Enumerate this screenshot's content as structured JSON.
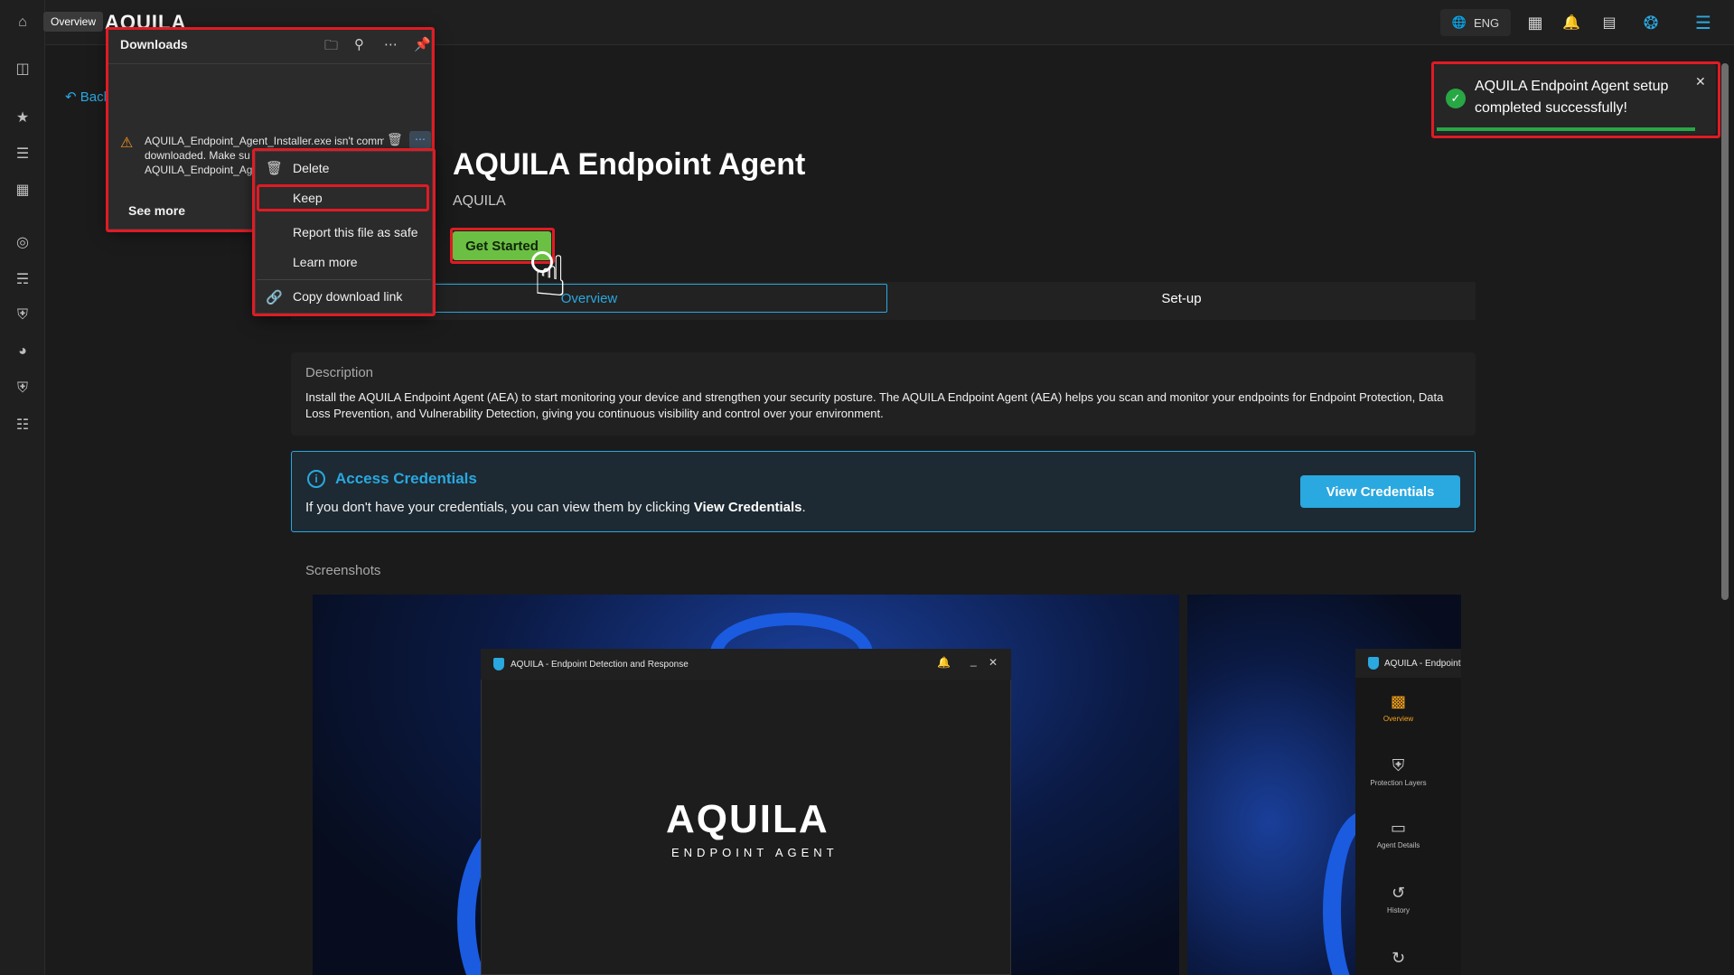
{
  "tooltip": "Overview",
  "brand": "AQUILA",
  "topbar": {
    "lang": "ENG"
  },
  "back_label": "Back",
  "product": {
    "title": "AQUILA Endpoint Agent",
    "vendor": "AQUILA",
    "get_started": "Get Started"
  },
  "tabs": [
    {
      "label": "Overview"
    },
    {
      "label": "Set-up"
    }
  ],
  "description": {
    "heading": "Description",
    "text": "Install the AQUILA Endpoint Agent (AEA) to start monitoring your device and strengthen your security posture. The AQUILA Endpoint Agent (AEA) helps you scan and monitor your endpoints for Endpoint Protection, Data Loss Prevention, and Vulnerability Detection, giving you continuous visibility and control over your environment."
  },
  "credentials": {
    "heading": "Access Credentials",
    "text_prefix": "If you don't have your credentials, you can view them by clicking ",
    "text_bold": "View Credentials",
    "text_suffix": ".",
    "button": "View Credentials"
  },
  "screenshots": {
    "heading": "Screenshots",
    "shot1": {
      "window_title": "AQUILA - Endpoint Detection and Response",
      "logo": "AQUILA",
      "subtitle": "ENDPOINT AGENT"
    },
    "shot2": {
      "window_title": "AQUILA - Endpoint D",
      "nav": [
        {
          "label": "Overview"
        },
        {
          "label": "Protection Layers"
        },
        {
          "label": "Agent Details"
        },
        {
          "label": "History"
        }
      ]
    }
  },
  "toast": {
    "message": "AQUILA Endpoint Agent setup completed successfully!"
  },
  "downloads": {
    "title": "Downloads",
    "item_line1": "AQUILA_Endpoint_Agent_Installer.exe isn't comm",
    "item_line2": "downloaded. Make su",
    "item_line3": "AQUILA_Endpoint_Age",
    "see_more": "See more",
    "menu": [
      {
        "label": "Delete"
      },
      {
        "label": "Keep"
      },
      {
        "label": "Report this file as safe"
      },
      {
        "label": "Learn more"
      },
      {
        "label": "Copy download link"
      }
    ]
  },
  "colors": {
    "accent": "#2aa8e0",
    "success": "#28a745",
    "cta": "#6bc043",
    "highlight": "#e01b24"
  }
}
